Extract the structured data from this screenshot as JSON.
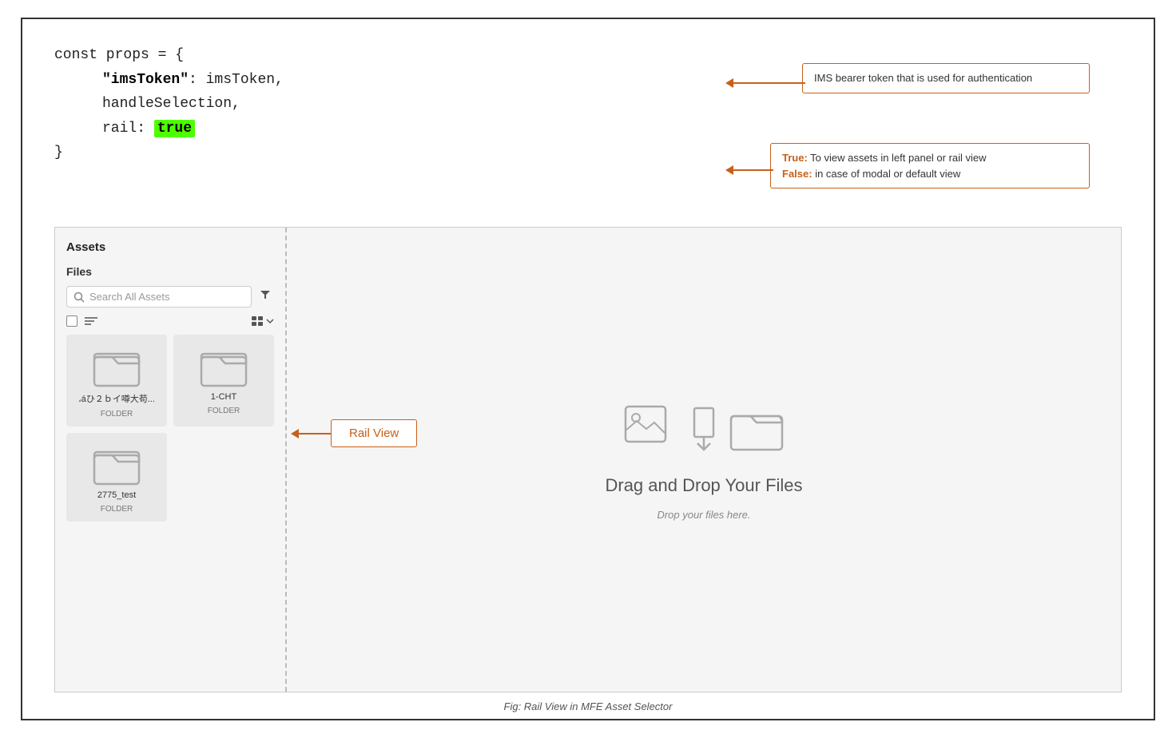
{
  "code": {
    "line1": "const props = {",
    "line2_key": "\"imsToken\"",
    "line2_val": ": imsToken,",
    "line3": "handleSelection,",
    "line4_prefix": "rail: ",
    "line4_val": "true",
    "line5": "}"
  },
  "callout1": {
    "text": "IMS bearer token that is used for authentication"
  },
  "callout2": {
    "true_label": "True:",
    "true_text": " To view assets in left panel or rail view",
    "false_label": "False:",
    "false_text": " in case of modal or default view"
  },
  "rail_callout": {
    "text": "Rail View"
  },
  "assets_panel": {
    "title": "Assets",
    "files_label": "Files",
    "search_placeholder": "Search All Assets",
    "folder1_name": "،áひ２ｂイ噂大苟...",
    "folder1_type": "FOLDER",
    "folder2_name": "1-CHT",
    "folder2_type": "FOLDER",
    "folder3_name": "2775_test",
    "folder3_type": "FOLDER"
  },
  "drop_area": {
    "title": "Drag and Drop Your Files",
    "subtitle": "Drop your files here."
  },
  "figure_caption": "Fig: Rail View in MFE Asset Selector"
}
